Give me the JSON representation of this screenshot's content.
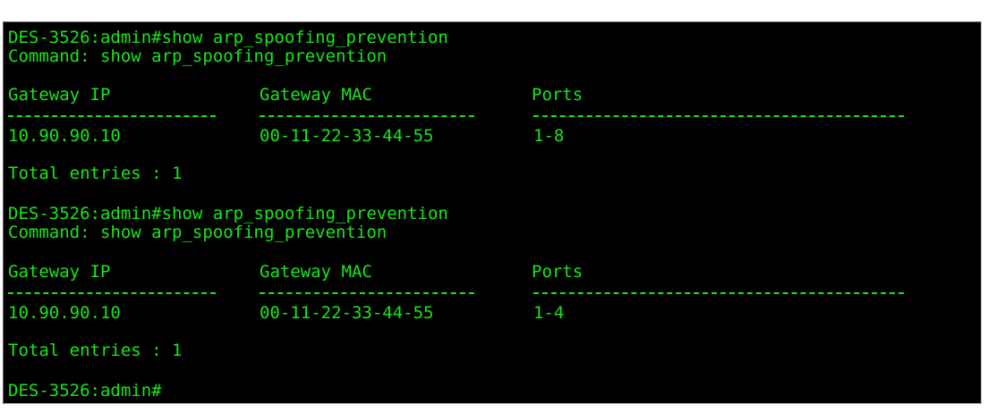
{
  "terminal": {
    "block1": {
      "prompt_line": "DES-3526:admin#show arp_spoofing_prevention",
      "command_line": "Command: show arp_spoofing_prevention",
      "headers": [
        "Gateway IP",
        "Gateway MAC",
        "Ports"
      ],
      "row": {
        "ip": "10.90.90.10",
        "mac": "00-11-22-33-44-55",
        "ports": "1-8"
      },
      "total": "Total entries : 1"
    },
    "block2": {
      "prompt_line": "DES-3526:admin#show arp_spoofing_prevention",
      "command_line": "Command: show arp_spoofing_prevention",
      "headers": [
        "Gateway IP",
        "Gateway MAC",
        "Ports"
      ],
      "row": {
        "ip": "10.90.90.10",
        "mac": "00-11-22-33-44-55",
        "ports": "1-4"
      },
      "total": "Total entries : 1"
    },
    "final_prompt": "DES-3526:admin#",
    "text_color": "#19e619",
    "background_color": "#000000"
  }
}
